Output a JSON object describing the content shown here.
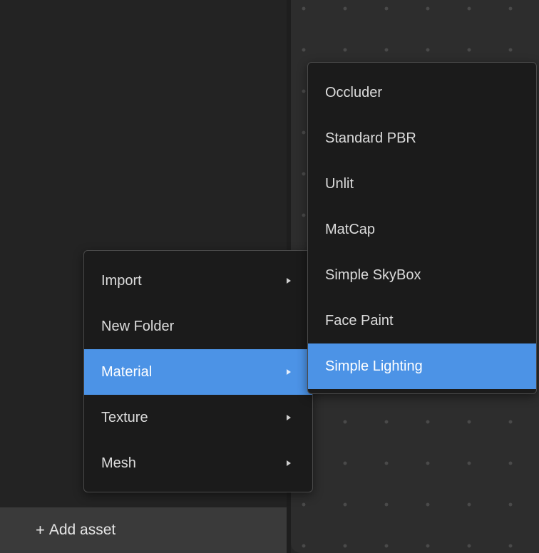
{
  "left_panel": {
    "add_asset": {
      "icon": "plus-icon",
      "icon_glyph": "+",
      "label": "Add asset"
    }
  },
  "main_menu": {
    "items": [
      {
        "label": "Import",
        "has_submenu": true,
        "active": false
      },
      {
        "label": "New Folder",
        "has_submenu": false,
        "active": false
      },
      {
        "label": "Material",
        "has_submenu": true,
        "active": true
      },
      {
        "label": "Texture",
        "has_submenu": true,
        "active": false
      },
      {
        "label": "Mesh",
        "has_submenu": true,
        "active": false
      }
    ]
  },
  "material_submenu": {
    "items": [
      {
        "label": "Occluder",
        "active": false
      },
      {
        "label": "Standard PBR",
        "active": false
      },
      {
        "label": "Unlit",
        "active": false
      },
      {
        "label": "MatCap",
        "active": false
      },
      {
        "label": "Simple SkyBox",
        "active": false
      },
      {
        "label": "Face Paint",
        "active": false
      },
      {
        "label": "Simple Lighting",
        "active": true
      }
    ]
  },
  "colors": {
    "accent": "#4c93e6",
    "menu_bg": "#1b1b1b",
    "panel_bg": "#232323",
    "canvas_bg": "#2d2d2d",
    "add_bar_bg": "#3a3a3a"
  }
}
